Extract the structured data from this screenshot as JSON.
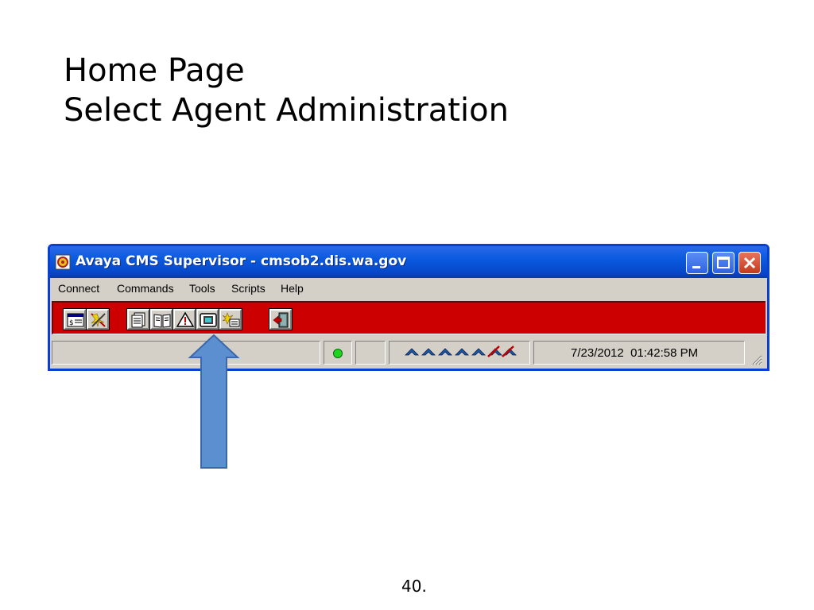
{
  "slide": {
    "title_line1": "Home Page",
    "title_line2": "Select Agent Administration",
    "page_number": "40."
  },
  "window": {
    "title": "Avaya CMS Supervisor - cmsob2.dis.wa.gov",
    "menu": [
      "Connect",
      "Commands",
      "Tools",
      "Scripts",
      "Help"
    ],
    "toolbar_color": "#cc0000",
    "toolbar_groups": [
      [
        "reports-icon",
        "dictionary-exceptions-icon"
      ],
      [
        "scripts-icon",
        "dictionary-icon",
        "exceptions-icon",
        "agent-administration-icon",
        "call-center-administration-icon"
      ],
      [
        "exit-icon"
      ]
    ],
    "status": {
      "connection_indicator": "green",
      "datetime": "7/23/2012  01:42:58 PM"
    }
  },
  "annotation": {
    "arrow_color": "#5b8fd0",
    "points_to": "agent-administration-icon"
  }
}
